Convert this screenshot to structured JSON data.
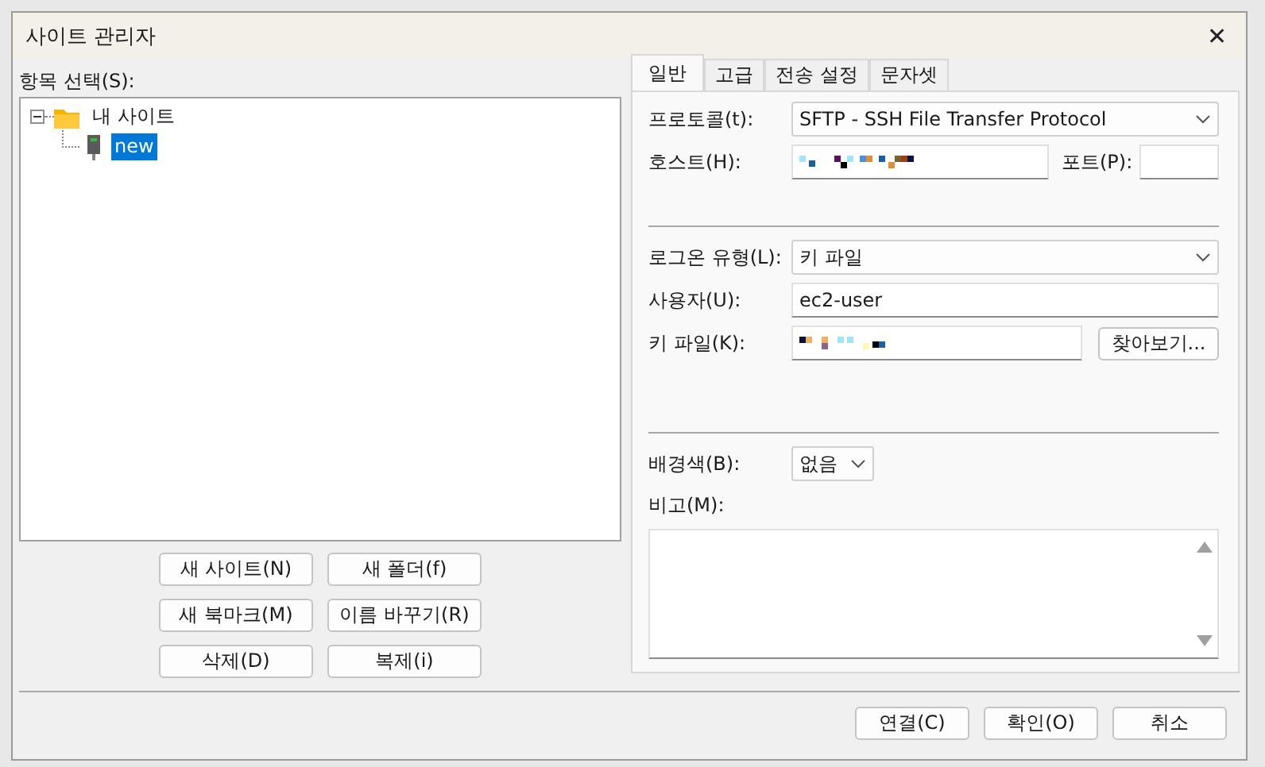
{
  "window": {
    "title": "사이트 관리자",
    "close": "✕"
  },
  "site_tree": {
    "label": "항목 선택(S):",
    "items": [
      {
        "label": "내 사이트",
        "kind": "folder",
        "expanded": true,
        "selected": false,
        "children": [
          {
            "label": "new",
            "kind": "server",
            "selected": true
          }
        ]
      }
    ]
  },
  "site_buttons": [
    "새 사이트(N)",
    "새 폴더(f)",
    "새 북마크(M)",
    "이름 바꾸기(R)",
    "삭제(D)",
    "복제(i)"
  ],
  "tabs": [
    {
      "label": "일반",
      "selected": true
    },
    {
      "label": "고급",
      "selected": false
    },
    {
      "label": "전송 설정",
      "selected": false
    },
    {
      "label": "문자셋",
      "selected": false
    }
  ],
  "general": {
    "protocol": {
      "label": "프로토콜(t):",
      "value": "SFTP - SSH File Transfer Protocol"
    },
    "host": {
      "label": "호스트(H):",
      "redacted": true
    },
    "port": {
      "label": "포트(P):"
    },
    "logon_type": {
      "label": "로그온 유형(L):",
      "value": "키 파일"
    },
    "user": {
      "label": "사용자(U):",
      "value": "ec2-user"
    },
    "key_file": {
      "label": "키 파일(K):",
      "redacted": true,
      "button": "찾아보기..."
    },
    "background_color": {
      "label": "배경색(B):",
      "value": "없음"
    },
    "comments": {
      "label": "비고(M):"
    }
  },
  "footer_buttons": [
    "연결(C)",
    "확인(O)",
    "취소"
  ]
}
